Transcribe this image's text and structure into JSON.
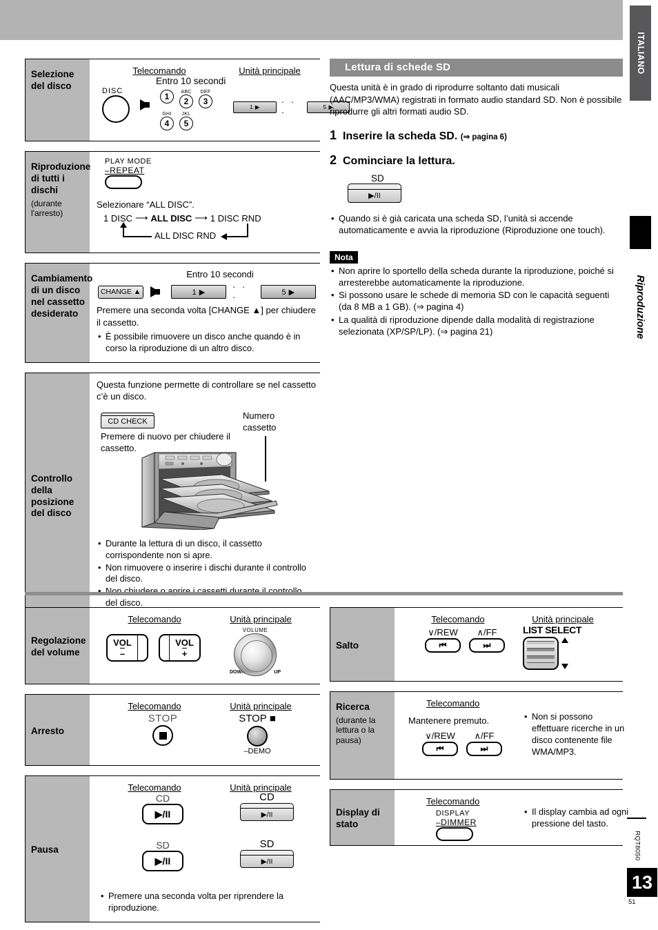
{
  "margin": {
    "language_tab": "ITALIANO",
    "section_label": "Riproduzione",
    "doc_code": "RQT8050",
    "page_number": "13",
    "page_sub": "51"
  },
  "left_column_top": {
    "rows": [
      {
        "label": "Selezione del disco",
        "sublabel": "",
        "col_headers": [
          "Telecomando",
          "Unità principale"
        ],
        "timing_note": "Entro 10 secondi",
        "remote_knob_label": "DISC",
        "number_keys": [
          {
            "digit": "1",
            "letters": ""
          },
          {
            "digit": "2",
            "letters": "ABC"
          },
          {
            "digit": "3",
            "letters": "DEF"
          },
          {
            "digit": "4",
            "letters": "GHI"
          },
          {
            "digit": "5",
            "letters": "JKL"
          }
        ],
        "unit_keys": [
          "1 ▶",
          "5 ▶"
        ],
        "unit_dots": "· · ·"
      },
      {
        "label": "Riproduzione di tutti i dischi",
        "sublabel": "(durante l'arresto)",
        "button_caption_line1": "PLAY MODE",
        "button_caption_line2": "–REPEAT",
        "instruction": "Selezionare “ALL DISC”.",
        "cycle": [
          "1 DISC",
          "ALL DISC",
          "1 DISC RND",
          "ALL DISC RND"
        ]
      },
      {
        "label": "Cambiamento di un disco nel cassetto desiderato",
        "timing_note": "Entro 10 secondi",
        "change_button": "CHANGE ▲",
        "unit_keys": [
          "1 ▶",
          "5 ▶"
        ],
        "unit_dots": "· · ·",
        "text": "Premere una seconda volta [CHANGE ▲] per chiudere il cassetto.",
        "bullets": [
          "È possibile rimuovere un disco anche quando è in corso la riproduzione di un altro disco."
        ]
      },
      {
        "label": "Controllo della posizione del disco",
        "intro": "Questa funzione permette di controllare se nel cassetto c’è un disco.",
        "cd_check_button": "CD CHECK",
        "text": "Premere di nuovo per chiudere il cassetto.",
        "callout": "Numero cassetto",
        "bullets": [
          "Durante la lettura di un disco, il cassetto corrispondente non si apre.",
          "Non rimuovere o inserire i dischi durante il controllo del disco.",
          "Non chiudere o aprire i cassetti durante il controllo del disco."
        ]
      }
    ]
  },
  "right_column_top": {
    "section_title": "Lettura di schede SD",
    "intro": "Questa unità è in grado di riprodurre soltanto dati musicali (AAC/MP3/WMA) registrati in formato audio standard SD.  Non è possibile riprodurre gli altri formati audio SD.",
    "steps": [
      {
        "number": "1",
        "text": "Inserire la scheda SD.",
        "reference": "(⇒ pagina 6)"
      },
      {
        "number": "2",
        "text": "Cominciare la lettura.",
        "reference": ""
      }
    ],
    "sd_button_label": "SD",
    "sd_button_glyph": "▶/II",
    "bullets": [
      "Quando si è già caricata una scheda SD, l’unità si accende automaticamente e avvia la riproduzione (Riproduzione one touch)."
    ],
    "nota_badge": "Nota",
    "nota_bullets": [
      "Non aprire lo sportello della scheda durante la riproduzione, poiché si arresterebbe automaticamente la riproduzione.",
      "Si possono usare le schede di memoria SD con le capacità seguenti (da 8 MB a 1 GB). (⇒ pagina 4)",
      "La qualità di riproduzione dipende dalla modalità di registrazione selezionata (XP/SP/LP). (⇒ pagina 21)"
    ]
  },
  "left_column_bottom": {
    "rows": [
      {
        "label": "Regolazione del volume",
        "col_headers": [
          "Telecomando",
          "Unità principale"
        ],
        "remote_buttons": [
          {
            "line1": "VOL",
            "line2": "–"
          },
          {
            "line1": "VOL",
            "line2": "+"
          }
        ],
        "knob_label": "VOLUME",
        "knob_min": "DOWN",
        "knob_max": "UP"
      },
      {
        "label": "Arresto",
        "col_headers": [
          "Telecomando",
          "Unità principale"
        ],
        "remote_caption": "STOP",
        "unit_caption": "STOP ■",
        "unit_sub_caption": "–DEMO"
      },
      {
        "label": "Pausa",
        "col_headers": [
          "Telecomando",
          "Unità principale"
        ],
        "remote_groups": [
          {
            "caption": "CD",
            "glyph": "▶/II"
          },
          {
            "caption": "SD",
            "glyph": "▶/II"
          }
        ],
        "unit_groups": [
          {
            "caption": "CD",
            "glyph": "▶/II"
          },
          {
            "caption": "SD",
            "glyph": "▶/II"
          }
        ],
        "bullets": [
          "Premere una seconda volta per riprendere la riproduzione."
        ]
      }
    ]
  },
  "right_column_bottom": {
    "rows": [
      {
        "label": "Salto",
        "col_headers": [
          "Telecomando",
          "Unità principale"
        ],
        "remote_buttons": [
          {
            "caption": "∨/REW",
            "glyph": "◀◀"
          },
          {
            "caption": "∧/FF",
            "glyph": "▶▶"
          }
        ],
        "unit_caption": "LIST SELECT"
      },
      {
        "label": "Ricerca",
        "sublabel": "(durante la lettura o la pausa)",
        "col_header": "Telecomando",
        "hold_text": "Mantenere premuto.",
        "remote_buttons": [
          {
            "caption": "∨/REW",
            "glyph": "◀◀"
          },
          {
            "caption": "∧/FF",
            "glyph": "▶▶"
          }
        ],
        "bullets": [
          "Non si possono effettuare ricerche in un disco contenente file WMA/MP3."
        ]
      },
      {
        "label": "Display di stato",
        "col_header": "Telecomando",
        "button_caption_line1": "DISPLAY",
        "button_caption_line2": "–DIMMER",
        "bullets": [
          "Il display cambia ad ogni pressione del tasto."
        ]
      }
    ]
  }
}
